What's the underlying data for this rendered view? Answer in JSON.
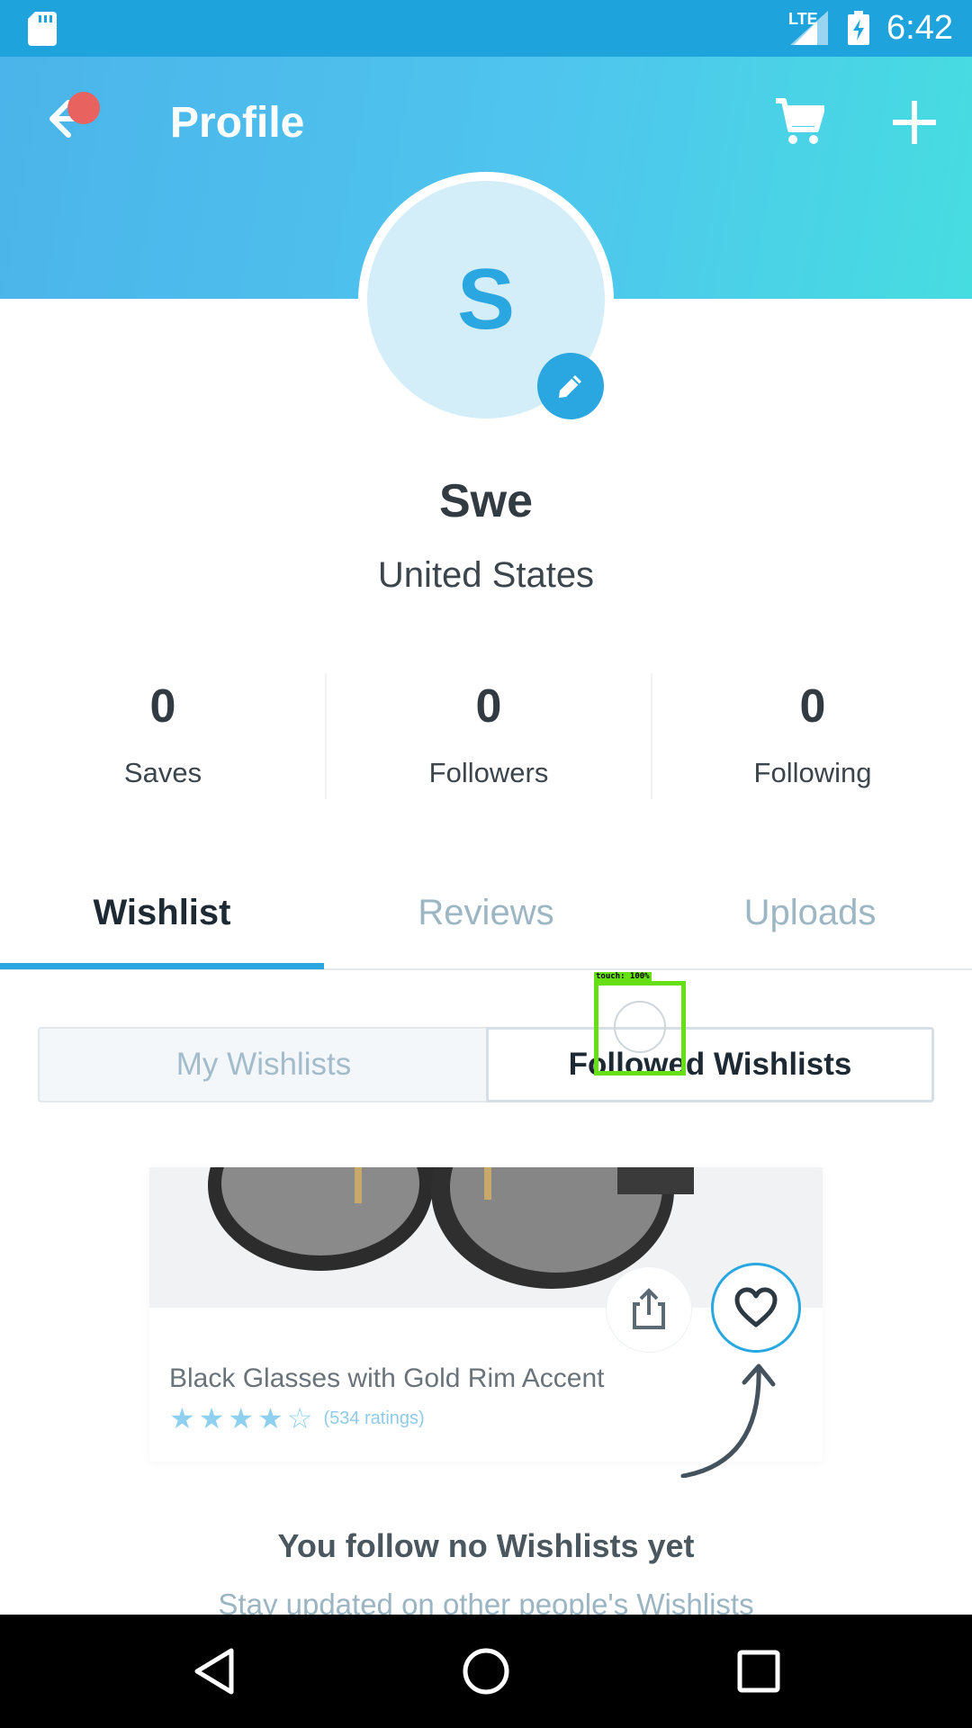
{
  "status_bar": {
    "network": "LTE",
    "time": "6:42"
  },
  "header": {
    "title": "Profile",
    "accent_color": "#4fc5ee"
  },
  "profile": {
    "avatar_initial": "S",
    "name": "Swe",
    "country": "United States"
  },
  "stats": [
    {
      "value": "0",
      "label": "Saves"
    },
    {
      "value": "0",
      "label": "Followers"
    },
    {
      "value": "0",
      "label": "Following"
    }
  ],
  "tabs": [
    {
      "label": "Wishlist",
      "active": true
    },
    {
      "label": "Reviews",
      "active": false
    },
    {
      "label": "Uploads",
      "active": false
    }
  ],
  "segments": {
    "left": "My Wishlists",
    "right": "Followed Wishlists",
    "selected": "Followed Wishlists"
  },
  "touch_overlay": {
    "label": "touch: 100%"
  },
  "product_card": {
    "title": "Black Glasses with Gold Rim Accent",
    "rating_stars": 4,
    "rating_max": 5,
    "ratings_text": "(534 ratings)"
  },
  "empty_state": {
    "title": "You follow no Wishlists yet",
    "subtitle": "Stay updated on other people's Wishlists"
  },
  "icons": {
    "back": "arrow-left-icon",
    "cart": "cart-icon",
    "add": "plus-icon",
    "edit": "pencil-icon",
    "share": "share-icon",
    "favorite": "heart-icon"
  }
}
